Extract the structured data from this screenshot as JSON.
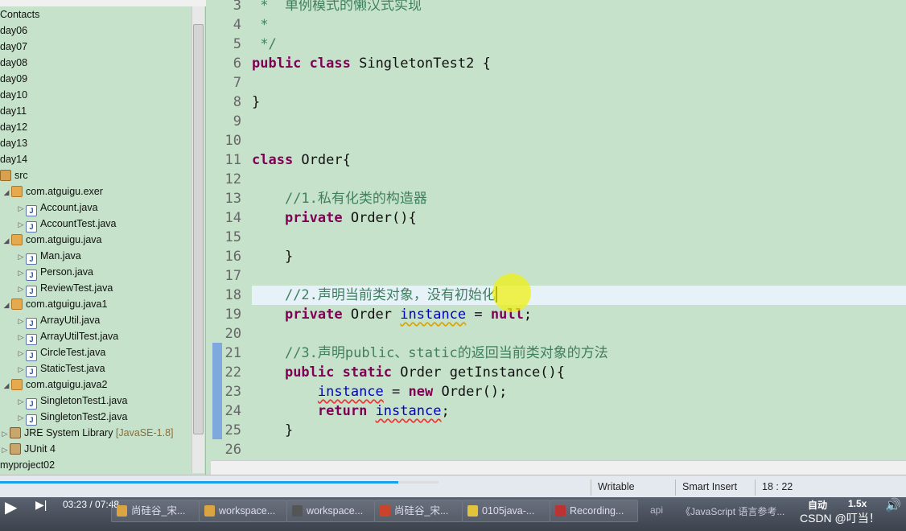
{
  "sidebar": {
    "items": [
      {
        "label": "Contacts",
        "depth": 0,
        "icon": "none",
        "twisty": ""
      },
      {
        "label": "day06",
        "depth": 0,
        "icon": "none",
        "twisty": ""
      },
      {
        "label": "day07",
        "depth": 0,
        "icon": "none",
        "twisty": ""
      },
      {
        "label": "day08",
        "depth": 0,
        "icon": "none",
        "twisty": ""
      },
      {
        "label": "day09",
        "depth": 0,
        "icon": "none",
        "twisty": ""
      },
      {
        "label": "day10",
        "depth": 0,
        "icon": "none",
        "twisty": ""
      },
      {
        "label": "day11",
        "depth": 0,
        "icon": "none",
        "twisty": ""
      },
      {
        "label": "day12",
        "depth": 0,
        "icon": "none",
        "twisty": ""
      },
      {
        "label": "day13",
        "depth": 0,
        "icon": "none",
        "twisty": ""
      },
      {
        "label": "day14",
        "depth": 0,
        "icon": "none",
        "twisty": ""
      },
      {
        "label": "src",
        "depth": 0,
        "icon": "src",
        "twisty": ""
      },
      {
        "label": "com.atguigu.exer",
        "depth": 1,
        "icon": "pkg",
        "twisty": "◢"
      },
      {
        "label": "Account.java",
        "depth": 2,
        "icon": "java",
        "twisty": "▷"
      },
      {
        "label": "AccountTest.java",
        "depth": 2,
        "icon": "java",
        "twisty": "▷"
      },
      {
        "label": "com.atguigu.java",
        "depth": 1,
        "icon": "pkg",
        "twisty": "◢"
      },
      {
        "label": "Man.java",
        "depth": 2,
        "icon": "java",
        "twisty": "▷"
      },
      {
        "label": "Person.java",
        "depth": 2,
        "icon": "java",
        "twisty": "▷"
      },
      {
        "label": "ReviewTest.java",
        "depth": 2,
        "icon": "java",
        "twisty": "▷"
      },
      {
        "label": "com.atguigu.java1",
        "depth": 1,
        "icon": "pkg",
        "twisty": "◢"
      },
      {
        "label": "ArrayUtil.java",
        "depth": 2,
        "icon": "java",
        "twisty": "▷"
      },
      {
        "label": "ArrayUtilTest.java",
        "depth": 2,
        "icon": "java",
        "twisty": "▷"
      },
      {
        "label": "CircleTest.java",
        "depth": 2,
        "icon": "java",
        "twisty": "▷"
      },
      {
        "label": "StaticTest.java",
        "depth": 2,
        "icon": "java",
        "twisty": "▷"
      },
      {
        "label": "com.atguigu.java2",
        "depth": 1,
        "icon": "pkg",
        "twisty": "◢"
      },
      {
        "label": "SingletonTest1.java",
        "depth": 2,
        "icon": "java",
        "twisty": "▷"
      },
      {
        "label": "SingletonTest2.java",
        "depth": 2,
        "icon": "java",
        "twisty": "▷"
      },
      {
        "label": "JRE System Library",
        "suffix": "[JavaSE-1.8]",
        "depth": 0,
        "icon": "lib",
        "twisty": "▷"
      },
      {
        "label": "JUnit 4",
        "depth": 0,
        "icon": "lib",
        "twisty": "▷"
      },
      {
        "label": "myproject02",
        "depth": 0,
        "icon": "none",
        "twisty": ""
      }
    ]
  },
  "editor": {
    "lines": [
      {
        "n": "3",
        "t": [
          {
            "s": " *  单例模式的懒汉式实现",
            "c": "cm"
          }
        ]
      },
      {
        "n": "4",
        "t": [
          {
            "s": " *",
            "c": "cm"
          }
        ]
      },
      {
        "n": "5",
        "t": [
          {
            "s": " */",
            "c": "cm"
          }
        ]
      },
      {
        "n": "6",
        "t": [
          {
            "s": "public",
            "c": "kw"
          },
          {
            "s": " "
          },
          {
            "s": "class",
            "c": "kw"
          },
          {
            "s": " SingletonTest2 {"
          }
        ]
      },
      {
        "n": "7",
        "t": []
      },
      {
        "n": "8",
        "t": [
          {
            "s": "}"
          }
        ]
      },
      {
        "n": "9",
        "t": []
      },
      {
        "n": "10",
        "t": []
      },
      {
        "n": "11",
        "t": [
          {
            "s": "class",
            "c": "kw"
          },
          {
            "s": " Order{"
          }
        ]
      },
      {
        "n": "12",
        "t": []
      },
      {
        "n": "13",
        "t": [
          {
            "s": "    "
          },
          {
            "s": "//1.私有化类的构造器",
            "c": "cm"
          }
        ]
      },
      {
        "n": "14",
        "t": [
          {
            "s": "    "
          },
          {
            "s": "private",
            "c": "kw"
          },
          {
            "s": " Order(){"
          }
        ]
      },
      {
        "n": "15",
        "t": []
      },
      {
        "n": "16",
        "t": [
          {
            "s": "    }"
          }
        ]
      },
      {
        "n": "17",
        "t": []
      },
      {
        "n": "18",
        "t": [
          {
            "s": "    "
          },
          {
            "s": "//2.声明当前类对象，没有初始化",
            "c": "cm"
          }
        ],
        "current": true
      },
      {
        "n": "19",
        "t": [
          {
            "s": "    "
          },
          {
            "s": "private",
            "c": "kw"
          },
          {
            "s": " Order "
          },
          {
            "s": "instance",
            "c": "fld warn"
          },
          {
            "s": " = "
          },
          {
            "s": "null",
            "c": "kw"
          },
          {
            "s": ";"
          }
        ]
      },
      {
        "n": "20",
        "t": []
      },
      {
        "n": "21",
        "t": [
          {
            "s": "    "
          },
          {
            "s": "//3.声明public、static的返回当前类对象的方法",
            "c": "cm"
          }
        ]
      },
      {
        "n": "22",
        "t": [
          {
            "s": "    "
          },
          {
            "s": "public",
            "c": "kw"
          },
          {
            "s": " "
          },
          {
            "s": "static",
            "c": "kw"
          },
          {
            "s": " Order getInstance(){"
          }
        ]
      },
      {
        "n": "23",
        "t": [
          {
            "s": "        "
          },
          {
            "s": "instance",
            "c": "fld err"
          },
          {
            "s": " = "
          },
          {
            "s": "new",
            "c": "kw"
          },
          {
            "s": " Order();"
          }
        ]
      },
      {
        "n": "24",
        "t": [
          {
            "s": "        "
          },
          {
            "s": "return",
            "c": "kw"
          },
          {
            "s": " "
          },
          {
            "s": "instance",
            "c": "fld err"
          },
          {
            "s": ";"
          }
        ]
      },
      {
        "n": "25",
        "t": [
          {
            "s": "    }"
          }
        ]
      },
      {
        "n": "26",
        "t": []
      }
    ]
  },
  "status": {
    "mode": "Writable",
    "insert": "Smart Insert",
    "position": "18 : 22"
  },
  "player": {
    "time": "03:23 / 07:48",
    "progress": 0.44,
    "speed": "1.5x",
    "auto": "自动"
  },
  "taskbar": {
    "items": [
      "尚硅谷_宋...",
      "workspace...",
      "workspace...",
      "尚硅谷_宋...",
      "0105java-...",
      "Recording..."
    ],
    "api": "api",
    "doc": "《JavaScript 语言参考...",
    "watermark": "CSDN @叮当！"
  }
}
